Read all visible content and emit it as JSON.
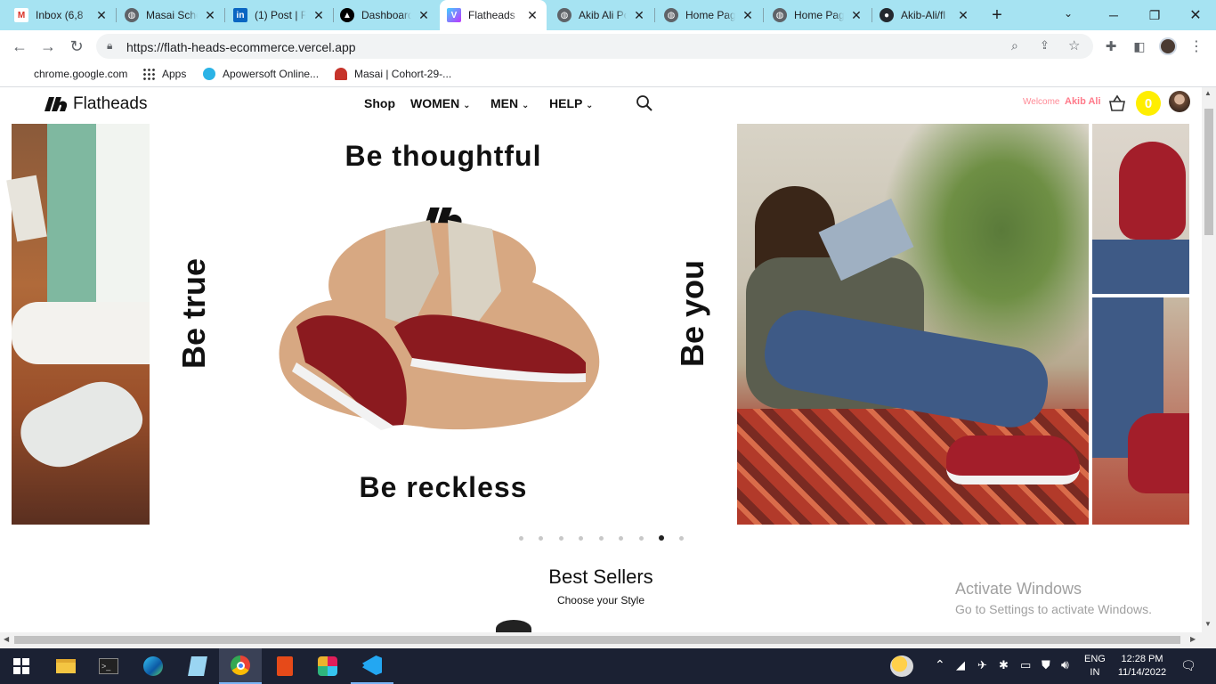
{
  "browser": {
    "tabs": [
      {
        "title": "Inbox (6,8",
        "icon": "gmail-icon"
      },
      {
        "title": "Masai Scho",
        "icon": "globe-icon"
      },
      {
        "title": "(1) Post | F",
        "icon": "linkedin-icon"
      },
      {
        "title": "Dashboard",
        "icon": "vercel-icon"
      },
      {
        "title": "Flatheads",
        "icon": "vite-icon",
        "active": true
      },
      {
        "title": "Akib Ali Po",
        "icon": "globe-icon"
      },
      {
        "title": "Home Pag",
        "icon": "globe-icon"
      },
      {
        "title": "Home Pag",
        "icon": "globe-icon"
      },
      {
        "title": "Akib-Ali/fl",
        "icon": "github-icon"
      }
    ],
    "url": "https://flath-heads-ecommerce.vercel.app",
    "bookmarks": [
      "chrome.google.com",
      "Apps",
      "Apowersoft Online...",
      "Masai | Cohort-29-..."
    ]
  },
  "site": {
    "brand": "Flatheads",
    "menu": {
      "shop": "Shop",
      "women": "WOMEN",
      "men": "MEN",
      "help": "HELP"
    },
    "welcome": "Welcome",
    "user": "Akib Ali",
    "cart_count": "0"
  },
  "hero": {
    "top": "Be thoughtful",
    "left": "Be true",
    "right": "Be you",
    "bottom": "Be reckless",
    "slide_count": 9,
    "active_slide": 8
  },
  "section": {
    "title": "Best Sellers",
    "subtitle": "Choose your Style"
  },
  "watermark": {
    "line1": "Activate Windows",
    "line2": "Go to Settings to activate Windows."
  },
  "taskbar": {
    "lang1": "ENG",
    "lang2": "IN",
    "time": "12:28 PM",
    "date": "11/14/2022"
  },
  "colors": {
    "tabstrip": "#a6e3f2",
    "accent_red": "#8b1a1f",
    "welcome_pink": "#ff7a8a",
    "cart_badge": "#ffee00"
  }
}
